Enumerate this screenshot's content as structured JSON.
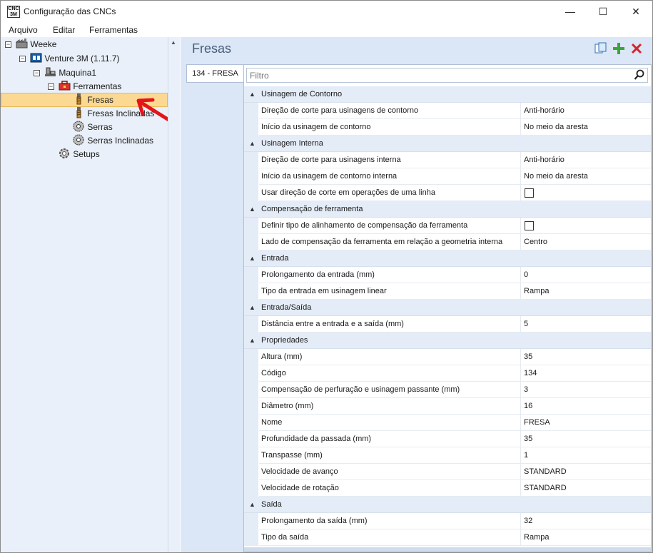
{
  "window": {
    "title": "Configuração das CNCs",
    "icon_text_top": "CNC",
    "icon_text_bottom": "3M",
    "minimize": "—",
    "maximize": "☐",
    "close": "✕"
  },
  "menu": {
    "items": [
      {
        "label": "Arquivo"
      },
      {
        "label": "Editar"
      },
      {
        "label": "Ferramentas"
      }
    ]
  },
  "tree": {
    "nodes": [
      {
        "label": "Weeke",
        "icon": "factory-icon",
        "expander": "−"
      },
      {
        "label": "Venture 3M (1.11.7)",
        "icon": "cnc-machine-icon",
        "expander": "−"
      },
      {
        "label": "Maquina1",
        "icon": "machine-icon",
        "expander": "−"
      },
      {
        "label": "Ferramentas",
        "icon": "toolbox-icon",
        "expander": "−"
      },
      {
        "label": "Fresas",
        "icon": "drill-bit-icon"
      },
      {
        "label": "Fresas Inclinadas",
        "icon": "drill-bit-icon"
      },
      {
        "label": "Serras",
        "icon": "saw-icon"
      },
      {
        "label": "Serras Inclinadas",
        "icon": "saw-icon"
      },
      {
        "label": "Setups",
        "icon": "gear-icon"
      }
    ]
  },
  "panel": {
    "title": "Fresas",
    "tab_label": "134 - FRESA",
    "filter_placeholder": "Filtro"
  },
  "grid": {
    "categories": [
      {
        "label": "Usinagem de Contorno",
        "props": [
          {
            "name": "Direção de corte para usinagens de contorno",
            "value": "Anti-horário"
          },
          {
            "name": "Início da usinagem de contorno",
            "value": "No meio da aresta"
          }
        ]
      },
      {
        "label": "Usinagem Interna",
        "props": [
          {
            "name": "Direção de corte para usinagens interna",
            "value": "Anti-horário"
          },
          {
            "name": "Início da usinagem de contorno interna",
            "value": "No meio da aresta"
          },
          {
            "name": "Usar direção de corte em operações de uma linha",
            "value": "",
            "checkbox": true
          }
        ]
      },
      {
        "label": "Compensação de ferramenta",
        "props": [
          {
            "name": "Definir tipo de alinhamento de compensação da ferramenta",
            "value": "",
            "checkbox": true
          },
          {
            "name": "Lado de compensação da ferramenta em relação a geometria interna",
            "value": "Centro"
          }
        ]
      },
      {
        "label": "Entrada",
        "props": [
          {
            "name": "Prolongamento da entrada (mm)",
            "value": "0"
          },
          {
            "name": "Tipo da entrada em usinagem linear",
            "value": "Rampa"
          }
        ]
      },
      {
        "label": "Entrada/Saída",
        "props": [
          {
            "name": "Distância entre a entrada e a saída (mm)",
            "value": "5"
          }
        ]
      },
      {
        "label": "Propriedades",
        "props": [
          {
            "name": "Altura (mm)",
            "value": "35"
          },
          {
            "name": "Código",
            "value": "134"
          },
          {
            "name": "Compensação de perfuração e usinagem passante (mm)",
            "value": "3"
          },
          {
            "name": "Diâmetro (mm)",
            "value": "16"
          },
          {
            "name": "Nome",
            "value": "FRESA"
          },
          {
            "name": "Profundidade da passada (mm)",
            "value": "35"
          },
          {
            "name": "Transpasse (mm)",
            "value": "1"
          },
          {
            "name": "Velocidade de avanço",
            "value": "STANDARD"
          },
          {
            "name": "Velocidade de rotação",
            "value": "STANDARD"
          }
        ]
      },
      {
        "label": "Saída",
        "props": [
          {
            "name": "Prolongamento da saída (mm)",
            "value": "32"
          },
          {
            "name": "Tipo da saída",
            "value": "Rampa"
          }
        ]
      }
    ]
  },
  "colors": {
    "selection": "#fcd993",
    "pane_bg": "#e9f0f9",
    "accent_arrow": "#e5141b",
    "add_icon": "#3aa53a",
    "delete_icon": "#d9242b"
  }
}
